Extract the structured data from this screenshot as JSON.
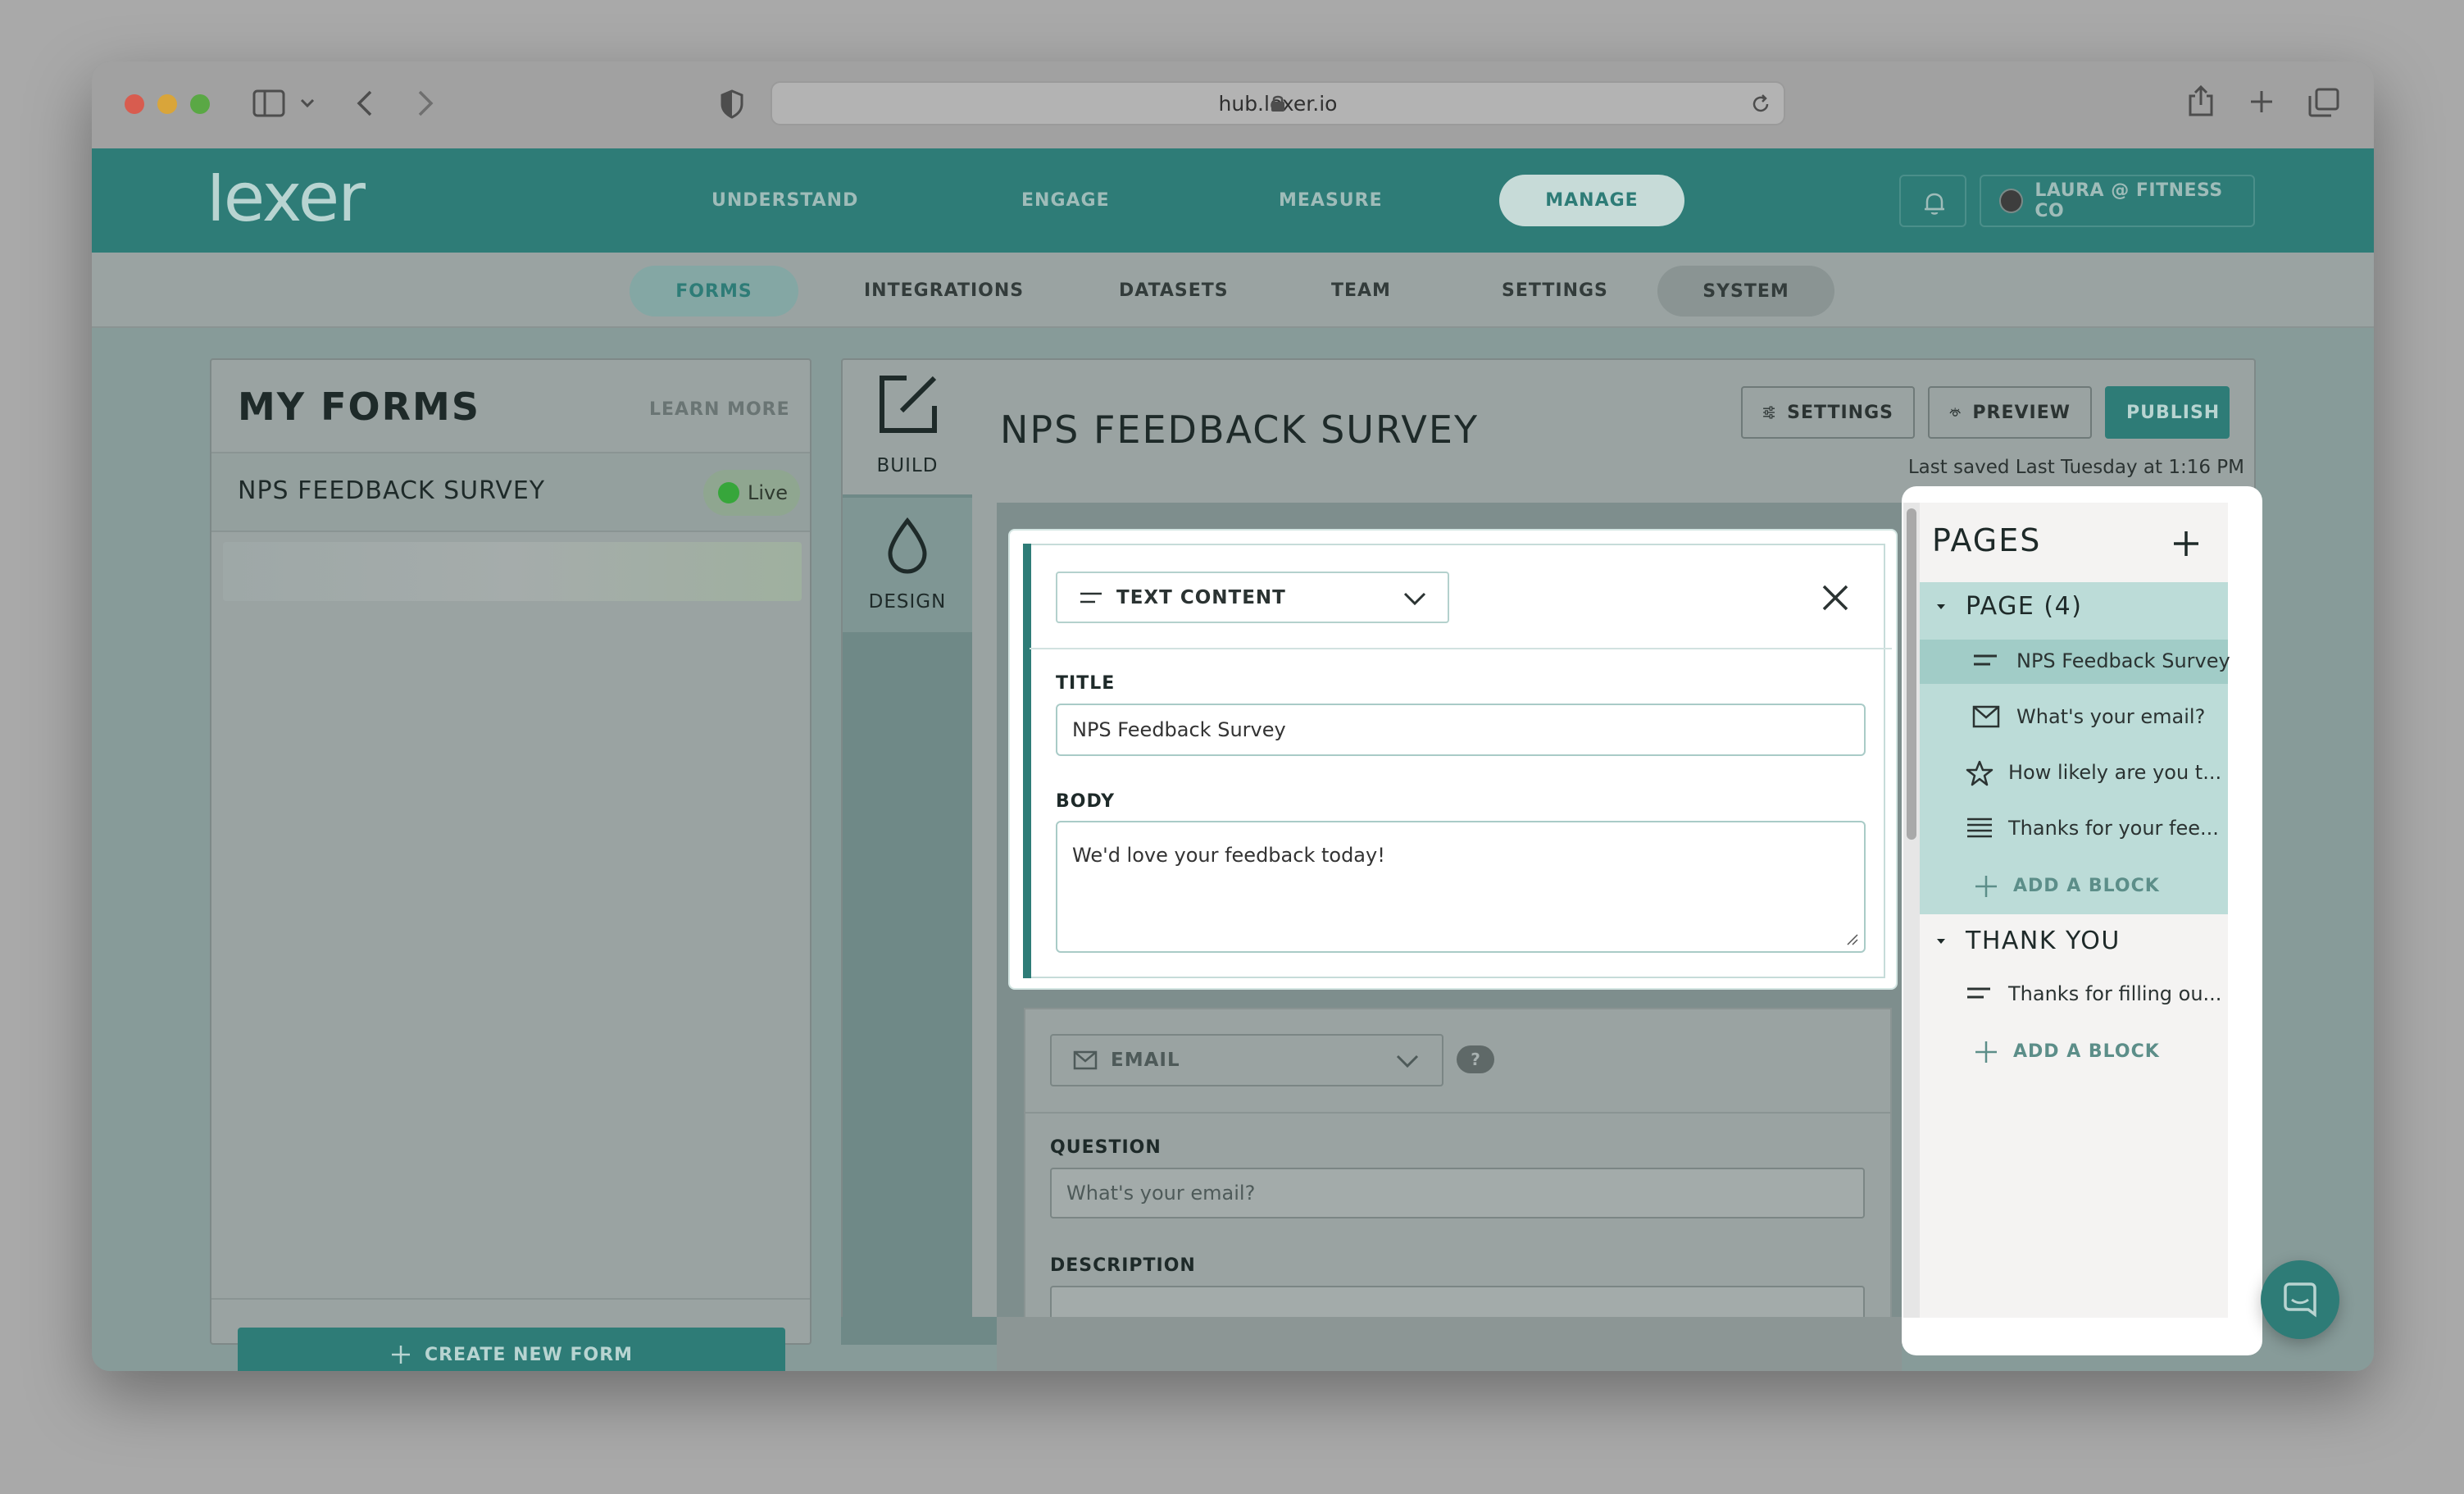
{
  "browser": {
    "url": "hub.lexer.io"
  },
  "brand": {
    "logo_text": "lexer",
    "accent": "#2e7c77"
  },
  "topnav": {
    "items": [
      "UNDERSTAND",
      "ENGAGE",
      "MEASURE",
      "MANAGE"
    ],
    "active": "MANAGE",
    "user_label": "LAURA @ FITNESS CO"
  },
  "subnav": {
    "items": [
      "FORMS",
      "INTEGRATIONS",
      "DATASETS",
      "TEAM",
      "SETTINGS",
      "SYSTEM"
    ],
    "active": "FORMS"
  },
  "my_forms": {
    "title": "MY FORMS",
    "learn_more": "LEARN MORE",
    "forms": [
      {
        "name": "NPS FEEDBACK SURVEY",
        "status": "Live"
      }
    ],
    "create_button": "CREATE NEW FORM"
  },
  "editor": {
    "rail": {
      "build": "BUILD",
      "design": "DESIGN"
    },
    "form_title": "NPS FEEDBACK SURVEY",
    "toolbar": {
      "settings": "SETTINGS",
      "preview": "PREVIEW",
      "publish": "PUBLISH"
    },
    "last_saved": "Last saved Last Tuesday at 1:16 PM"
  },
  "active_block": {
    "type": "TEXT CONTENT",
    "title_label": "TITLE",
    "title_value": "NPS Feedback Survey",
    "body_label": "BODY",
    "body_value": "We'd love your feedback today!"
  },
  "next_block": {
    "type": "EMAIL",
    "help": "?",
    "question_label": "QUESTION",
    "question_value": "What's your email?",
    "description_label": "DESCRIPTION"
  },
  "pages_panel": {
    "title": "PAGES",
    "groups": [
      {
        "name": "PAGE (4)",
        "items": [
          {
            "icon": "text-content-icon",
            "label": "NPS Feedback Survey"
          },
          {
            "icon": "email-icon",
            "label": "What's your email?"
          },
          {
            "icon": "star-icon",
            "label": "How likely are you t..."
          },
          {
            "icon": "paragraph-icon",
            "label": "Thanks for your fee..."
          }
        ],
        "add_label": "ADD A BLOCK"
      },
      {
        "name": "THANK YOU",
        "items": [
          {
            "icon": "text-content-icon",
            "label": "Thanks for filling ou..."
          }
        ],
        "add_label": "ADD A BLOCK"
      }
    ]
  }
}
